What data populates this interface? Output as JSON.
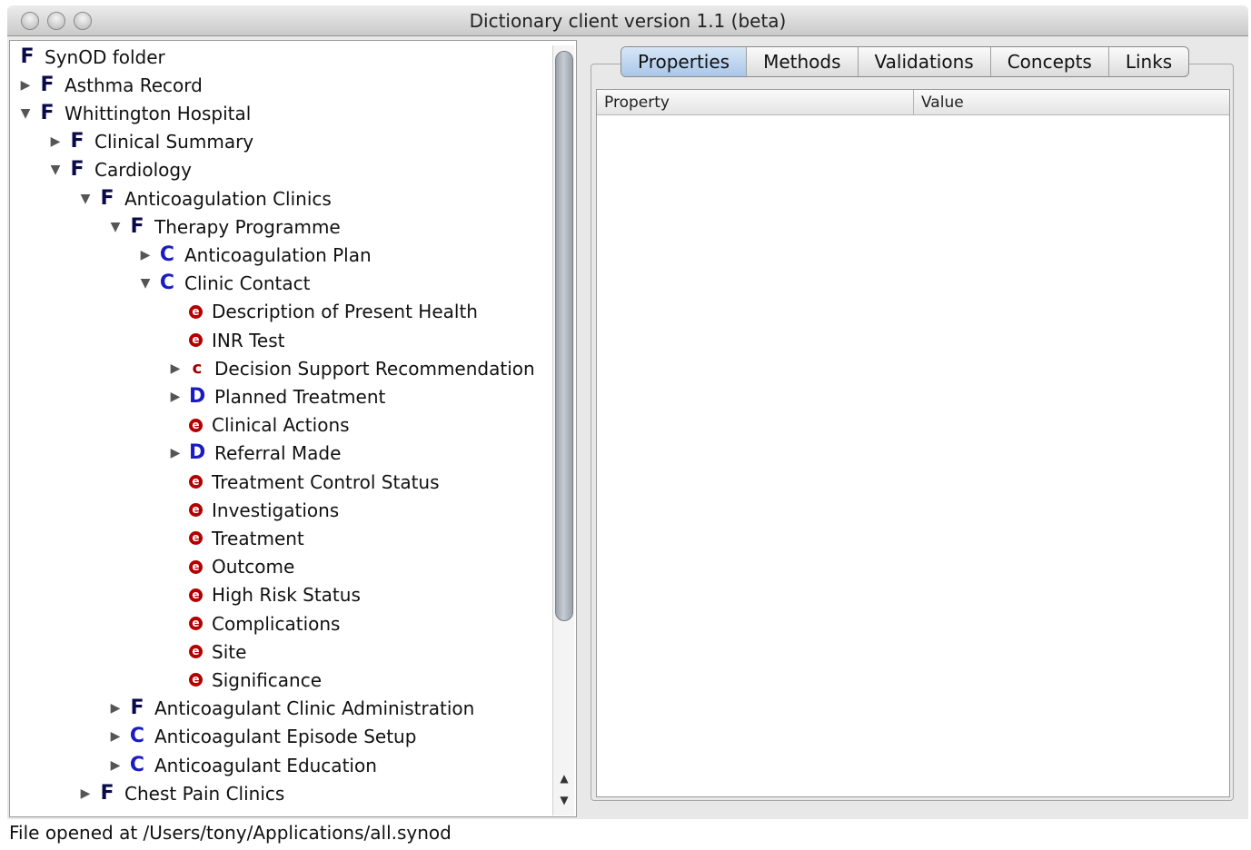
{
  "window": {
    "title": "Dictionary client version 1.1 (beta)"
  },
  "tree": [
    {
      "depth": 0,
      "arrow": "none",
      "icon": "F",
      "label": "SynOD folder"
    },
    {
      "depth": 0,
      "arrow": "collapsed",
      "icon": "F",
      "label": "Asthma Record"
    },
    {
      "depth": 0,
      "arrow": "expanded",
      "icon": "F",
      "label": "Whittington Hospital"
    },
    {
      "depth": 1,
      "arrow": "collapsed",
      "icon": "F",
      "label": "Clinical Summary"
    },
    {
      "depth": 1,
      "arrow": "expanded",
      "icon": "F",
      "label": "Cardiology"
    },
    {
      "depth": 2,
      "arrow": "expanded",
      "icon": "F",
      "label": "Anticoagulation Clinics"
    },
    {
      "depth": 3,
      "arrow": "expanded",
      "icon": "F",
      "label": "Therapy Programme"
    },
    {
      "depth": 4,
      "arrow": "collapsed",
      "icon": "C",
      "label": "Anticoagulation Plan"
    },
    {
      "depth": 4,
      "arrow": "expanded",
      "icon": "C",
      "label": "Clinic Contact"
    },
    {
      "depth": 5,
      "arrow": "none",
      "icon": "e",
      "label": "Description of Present Health"
    },
    {
      "depth": 5,
      "arrow": "none",
      "icon": "e",
      "label": "INR Test"
    },
    {
      "depth": 5,
      "arrow": "collapsed",
      "icon": "c",
      "label": "Decision Support Recommendation"
    },
    {
      "depth": 5,
      "arrow": "collapsed",
      "icon": "D",
      "label": "Planned Treatment"
    },
    {
      "depth": 5,
      "arrow": "none",
      "icon": "e",
      "label": "Clinical Actions"
    },
    {
      "depth": 5,
      "arrow": "collapsed",
      "icon": "D",
      "label": "Referral Made"
    },
    {
      "depth": 5,
      "arrow": "none",
      "icon": "e",
      "label": "Treatment Control Status"
    },
    {
      "depth": 5,
      "arrow": "none",
      "icon": "e",
      "label": "Investigations"
    },
    {
      "depth": 5,
      "arrow": "none",
      "icon": "e",
      "label": "Treatment"
    },
    {
      "depth": 5,
      "arrow": "none",
      "icon": "e",
      "label": "Outcome"
    },
    {
      "depth": 5,
      "arrow": "none",
      "icon": "e",
      "label": "High Risk Status"
    },
    {
      "depth": 5,
      "arrow": "none",
      "icon": "e",
      "label": "Complications"
    },
    {
      "depth": 5,
      "arrow": "none",
      "icon": "e",
      "label": "Site"
    },
    {
      "depth": 5,
      "arrow": "none",
      "icon": "e",
      "label": "Significance"
    },
    {
      "depth": 3,
      "arrow": "collapsed",
      "icon": "F",
      "label": "Anticoagulant Clinic Administration"
    },
    {
      "depth": 3,
      "arrow": "collapsed",
      "icon": "C",
      "label": "Anticoagulant Episode Setup"
    },
    {
      "depth": 3,
      "arrow": "collapsed",
      "icon": "C",
      "label": "Anticoagulant Education"
    },
    {
      "depth": 2,
      "arrow": "collapsed",
      "icon": "F",
      "label": "Chest Pain Clinics"
    }
  ],
  "tabs": [
    {
      "label": "Properties",
      "active": true
    },
    {
      "label": "Methods",
      "active": false
    },
    {
      "label": "Validations",
      "active": false
    },
    {
      "label": "Concepts",
      "active": false
    },
    {
      "label": "Links",
      "active": false
    }
  ],
  "table": {
    "col_property": "Property",
    "col_value": "Value"
  },
  "status": {
    "text": "File opened at /Users/tony/Applications/all.synod"
  }
}
